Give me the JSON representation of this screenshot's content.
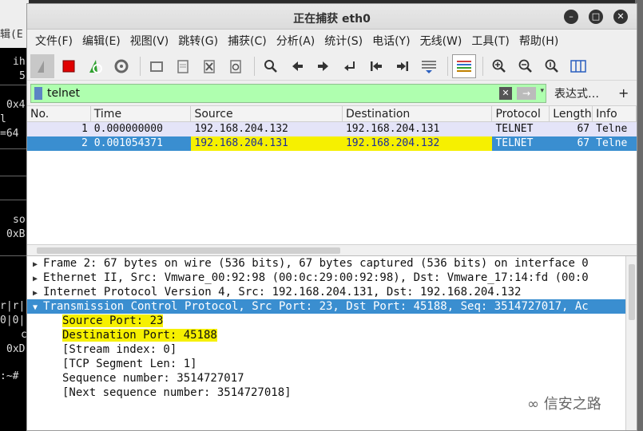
{
  "terminal": {
    "top": "辑(E",
    "lines": [
      "ih",
      "5",
      "0x4",
      "l",
      "=64",
      "so",
      "0xB",
      "r|r|",
      "0|0|",
      "c",
      "0xD",
      ":~#"
    ]
  },
  "window": {
    "title": "正在捕获 eth0",
    "controls": {
      "minimize": "–",
      "maximize": "□",
      "close": "✕"
    }
  },
  "menu": [
    "文件(F)",
    "编辑(E)",
    "视图(V)",
    "跳转(G)",
    "捕获(C)",
    "分析(A)",
    "统计(S)",
    "电话(Y)",
    "无线(W)",
    "工具(T)",
    "帮助(H)"
  ],
  "filter": {
    "value": "telnet",
    "expression_label": "表达式…",
    "add_label": "+",
    "clear": "✕",
    "apply": "→",
    "dropdown": "▾"
  },
  "packet_list": {
    "columns": [
      "No.",
      "Time",
      "Source",
      "Destination",
      "Protocol",
      "Length",
      "Info"
    ],
    "rows": [
      {
        "no": "1",
        "time": "0.000000000",
        "source": "192.168.204.132",
        "destination": "192.168.204.131",
        "protocol": "TELNET",
        "length": "67",
        "info": "Telne"
      },
      {
        "no": "2",
        "time": "0.001054371",
        "source": "192.168.204.131",
        "destination": "192.168.204.132",
        "protocol": "TELNET",
        "length": "67",
        "info": "Telne"
      }
    ],
    "selected_row": 2
  },
  "details": {
    "collapsed": [
      "Frame 2: 67 bytes on wire (536 bits), 67 bytes captured (536 bits) on interface 0",
      "Ethernet II, Src: Vmware_00:92:98 (00:0c:29:00:92:98), Dst: Vmware_17:14:fd (00:0",
      "Internet Protocol Version 4, Src: 192.168.204.131, Dst: 192.168.204.132"
    ],
    "selected": "Transmission Control Protocol, Src Port: 23, Dst Port: 45188, Seq: 3514727017, Ac",
    "fields": [
      "Source Port: 23",
      "Destination Port: 45188",
      "[Stream index: 0]",
      "[TCP Segment Len: 1]",
      "Sequence number: 3514727017",
      "[Next sequence number: 3514727018]"
    ]
  },
  "watermark": "信安之路",
  "highlight_color": "#f6f000",
  "selection_color": "#3a8ed0",
  "filter_bg_color": "#afffaf"
}
